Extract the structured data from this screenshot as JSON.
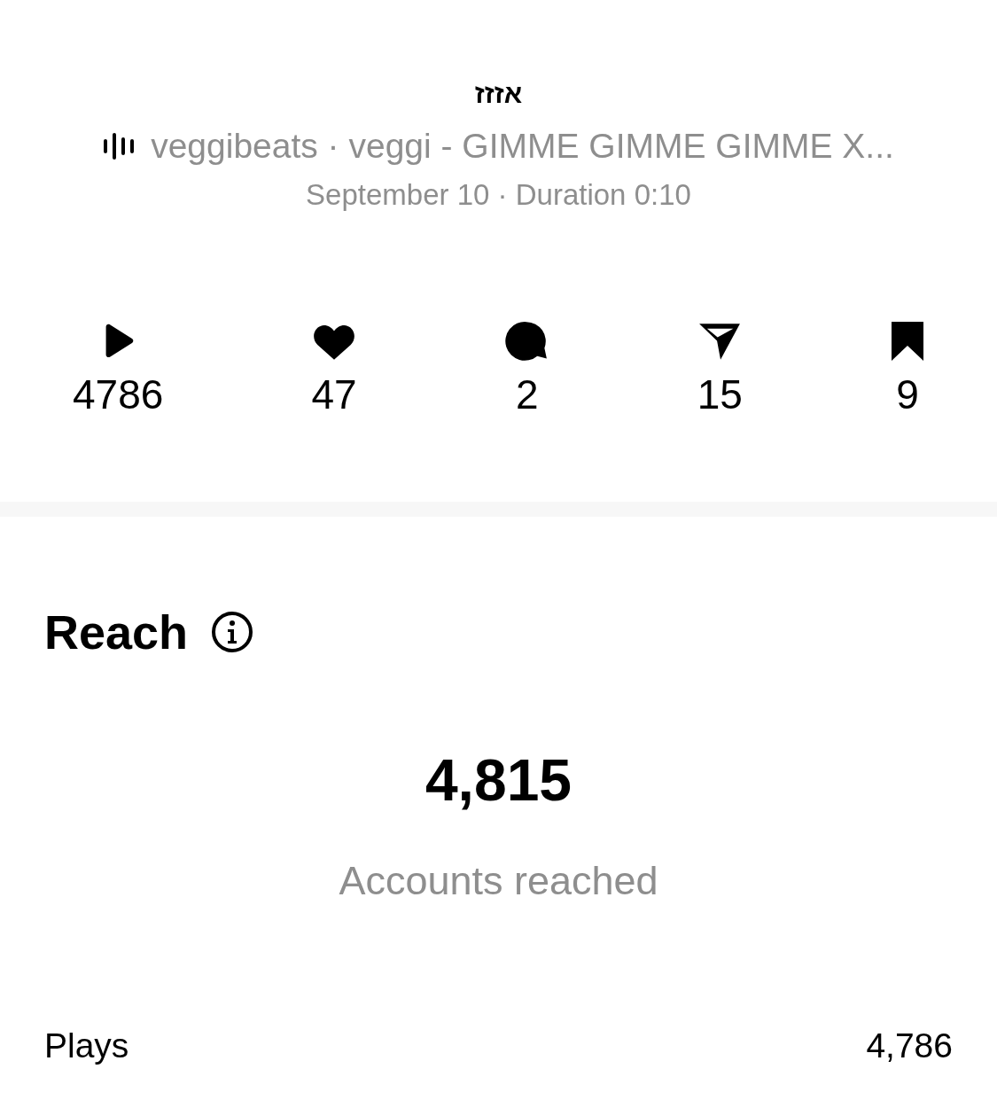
{
  "post": {
    "title": "אזזז",
    "audio": "veggibeats · veggi - GIMME GIMME GIMME X...",
    "meta": "September 10 · Duration 0:10"
  },
  "stats": [
    {
      "kind": "play",
      "value": "4786"
    },
    {
      "kind": "like",
      "value": "47"
    },
    {
      "kind": "comment",
      "value": "2"
    },
    {
      "kind": "share",
      "value": "15"
    },
    {
      "kind": "save",
      "value": "9"
    }
  ],
  "reach": {
    "title": "Reach",
    "total": "4,815",
    "caption": "Accounts reached",
    "rows": [
      {
        "label": "Plays",
        "value": "4,786"
      }
    ]
  }
}
